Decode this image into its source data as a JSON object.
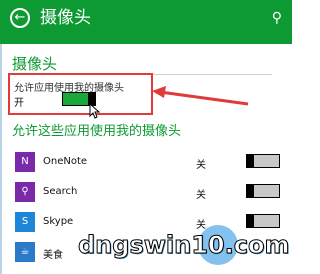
{
  "header": {
    "title": "摄像头",
    "back_icon": "back-arrow-icon",
    "search_icon": "search-icon"
  },
  "section": {
    "title": "摄像头",
    "allow_label": "允许应用使用我的摄像头",
    "toggle_state": "开"
  },
  "apps_section_title": "允许这些应用使用我的摄像头",
  "apps": [
    {
      "name": "OneNote",
      "state": "关",
      "icon": "onenote-icon",
      "color": "#7a2aa8"
    },
    {
      "name": "Search",
      "state": "关",
      "icon": "search-app-icon",
      "color": "#7a2aa8"
    },
    {
      "name": "Skype",
      "state": "关",
      "icon": "skype-icon",
      "color": "#1e86d9"
    },
    {
      "name": "美食",
      "state": "",
      "icon": "food-icon",
      "color": "#2a7ac9"
    }
  ],
  "watermark": "dngswin10.com",
  "colors": {
    "accent": "#0d9a32",
    "highlight": "#e03a3a",
    "toggle_on": "#19a83a"
  }
}
